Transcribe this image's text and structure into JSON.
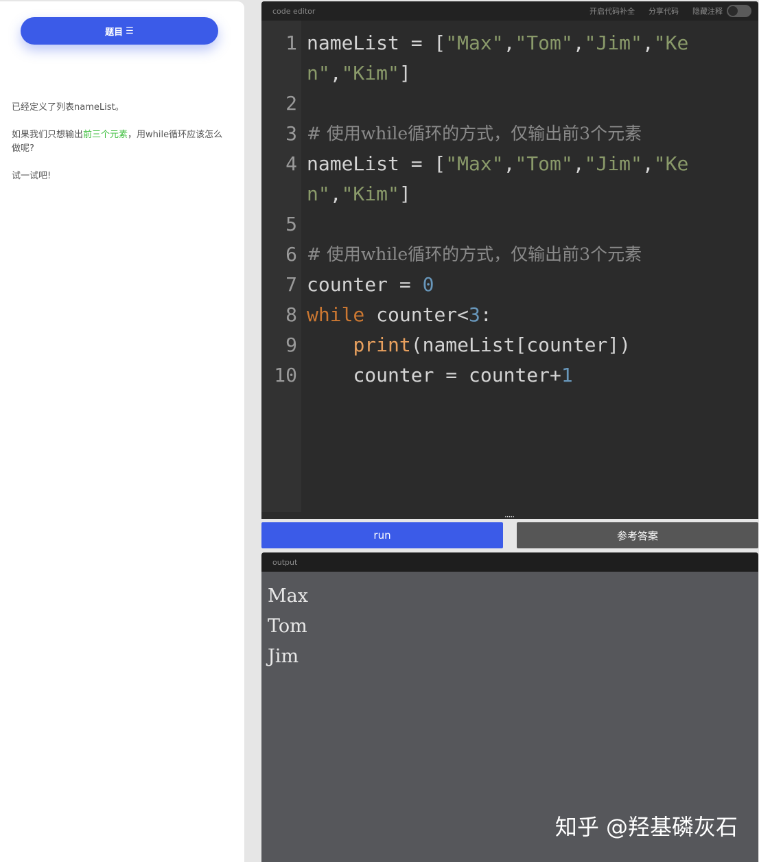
{
  "sidebar": {
    "topic_button": "题目",
    "menu_icon": "☰",
    "problem": {
      "line1": "已经定义了列表nameList。",
      "line2_before": "如果我们只想输出",
      "line2_highlight": "前三个元素",
      "line2_after": "，用while循环应该怎么做呢?",
      "line3": "试一试吧!"
    }
  },
  "editor": {
    "title": "code editor",
    "autocomplete_label": "开启代码补全",
    "share_label": "分享代码",
    "hide_comments_label": "隐藏注释",
    "lines": {
      "l1_num": "1",
      "l1_a": "nameList = [",
      "l1_s1": "\"Max\"",
      "l1_s2": "\"Tom\"",
      "l1_s3": "\"Jim\"",
      "l1_s4a": "\"Ke",
      "l1_s4b": "n\"",
      "l1_s5": "\"Kim\"",
      "l2_num": "2",
      "l3_num": "3",
      "l3_comment": "# 使用while循环的方式，仅输出前3个元素",
      "l4_num": "4",
      "l5_num": "5",
      "l6_num": "6",
      "l6_comment": "# 使用while循环的方式，仅输出前3个元素",
      "l7_num": "7",
      "l7_a": "counter = ",
      "l7_num_val": "0",
      "l8_num": "8",
      "l8_kw": "while",
      "l8_a": " counter<",
      "l8_num_val": "3",
      "l8_b": ":",
      "l9_num": "9",
      "l9_fn": "print",
      "l9_a": "(nameList[counter])",
      "l10_num": "10",
      "l10_a": "counter = counter+",
      "l10_num_val": "1"
    }
  },
  "buttons": {
    "run": "run",
    "answer": "参考答案"
  },
  "output": {
    "title": "output",
    "lines": [
      "Max",
      "Tom",
      "Jim"
    ]
  },
  "watermark": "知乎 @羟基磷灰石"
}
